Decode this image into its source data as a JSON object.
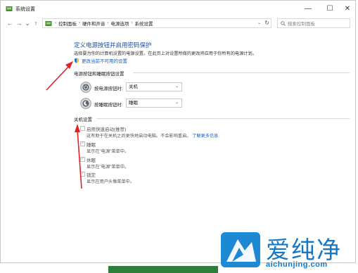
{
  "window": {
    "title": "系统设置",
    "minimize_glyph": "—",
    "maximize_glyph": "☐",
    "close_glyph": "✕"
  },
  "nav": {
    "back_glyph": "←",
    "forward_glyph": "→",
    "recent_glyph": "⌄",
    "up_glyph": "↑"
  },
  "breadcrumb": {
    "sep1": "›",
    "item1": "控制面板",
    "sep2": "›",
    "item2": "硬件和声音",
    "sep3": "›",
    "item3": "电源选项",
    "sep4": "›",
    "item4": "系统设置",
    "dropdown_glyph": "⌄",
    "refresh_glyph": "↻"
  },
  "search": {
    "placeholder": "搜索控制面板"
  },
  "main": {
    "heading": "定义电源按钮并启用密码保护",
    "description": "选择要为你的计算机设置的电源设置。在此页上对设置所做的更改将应用于你所有的电源计划。",
    "change_link": "更改当前不可用的设置"
  },
  "power_buttons": {
    "section_label": "电源按钮和睡眠按钮设置",
    "power_label": "按电源按钮时:",
    "power_value": "关机",
    "sleep_label": "按睡眠按钮时:",
    "sleep_value": "睡眠",
    "chevron": "⌄"
  },
  "shutdown": {
    "section_label": "关机设置",
    "items": [
      {
        "label": "启用快速启动(推荐)",
        "checked": false,
        "check_glyph": "",
        "sub": "这有助于在关机之后更快地启动电脑。不会影响重启。",
        "more_link": "了解更多信息"
      },
      {
        "label": "睡眠",
        "checked": true,
        "check_glyph": "✓",
        "sub": "显示在\"电源\"菜单中。"
      },
      {
        "label": "休眠",
        "checked": true,
        "check_glyph": "✓",
        "sub": "显示在\"电源\"菜单中。"
      },
      {
        "label": "锁定",
        "checked": true,
        "check_glyph": "✓",
        "sub": "显示在用户头像菜单中。"
      }
    ]
  },
  "watermark": {
    "text": "爱纯净",
    "url": "aichunjing.com"
  },
  "colors": {
    "heading": "#1f4e9c",
    "link": "#1a5fb4",
    "arrow": "#e02424",
    "watermark": "#1677c5"
  }
}
